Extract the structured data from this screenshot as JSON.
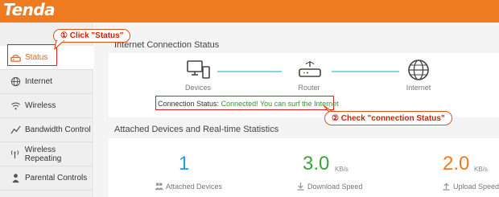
{
  "header": {
    "logo": "Tenda"
  },
  "sidebar": {
    "items": [
      {
        "label": "Status",
        "icon": "status-icon"
      },
      {
        "label": "Internet",
        "icon": "globe-icon"
      },
      {
        "label": "Wireless",
        "icon": "wifi-icon"
      },
      {
        "label": "Bandwidth Control",
        "icon": "chart-icon"
      },
      {
        "label": "Wireless Repeating",
        "icon": "antenna-icon"
      },
      {
        "label": "Parental Controls",
        "icon": "person-icon"
      }
    ]
  },
  "internet_status": {
    "title": "Internet Connection Status",
    "nodes": [
      "Devices",
      "Router",
      "Internet"
    ],
    "connection_label": "Connection Status:",
    "connection_value": "Connected! You can surf the Internet"
  },
  "attached": {
    "title": "Attached Devices and Real-time Statistics",
    "stats": [
      {
        "value": "1",
        "unit": "",
        "label": "Attached Devices",
        "color": "#2b9bd6"
      },
      {
        "value": "3.0",
        "unit": "KB/s",
        "label": "Download Speed",
        "color": "#3aa635"
      },
      {
        "value": "2.0",
        "unit": "KB/s",
        "label": "Upload Speed",
        "color": "#ee7b1f"
      }
    ]
  },
  "annotations": {
    "step1": "① Click \"Status\"",
    "step2": "② Check \"connection Status\""
  },
  "colors": {
    "accent": "#ee7b1f",
    "annotation_red": "#e02020"
  }
}
